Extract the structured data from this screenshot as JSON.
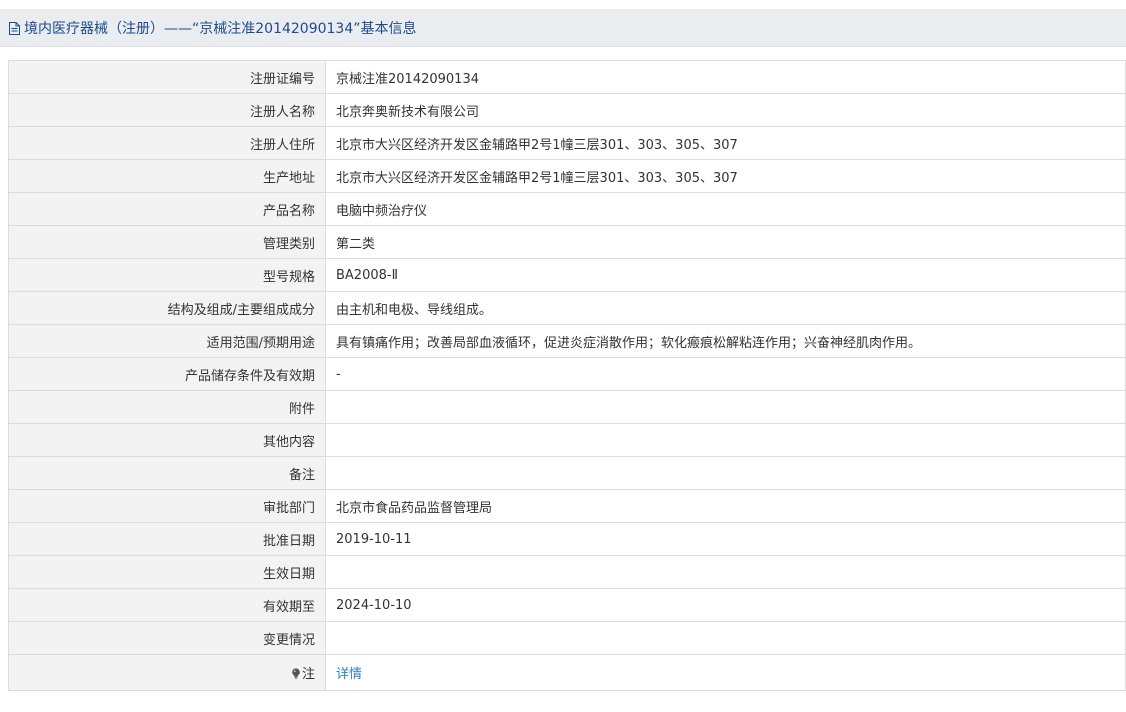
{
  "header": {
    "icon": "document-icon",
    "title": "境内医疗器械（注册）——“京械注准20142090134”基本信息"
  },
  "rows": [
    {
      "label": "注册证编号",
      "value": "京械注准20142090134"
    },
    {
      "label": "注册人名称",
      "value": "北京奔奥新技术有限公司"
    },
    {
      "label": "注册人住所",
      "value": "北京市大兴区经济开发区金辅路甲2号1幢三层301、303、305、307"
    },
    {
      "label": "生产地址",
      "value": "北京市大兴区经济开发区金辅路甲2号1幢三层301、303、305、307"
    },
    {
      "label": "产品名称",
      "value": "电脑中频治疗仪"
    },
    {
      "label": "管理类别",
      "value": "第二类"
    },
    {
      "label": "型号规格",
      "value": "BA2008-Ⅱ"
    },
    {
      "label": "结构及组成/主要组成成分",
      "value": "由主机和电极、导线组成。"
    },
    {
      "label": "适用范围/预期用途",
      "value": "具有镇痛作用；改善局部血液循环，促进炎症消散作用；软化瘢痕松解粘连作用；兴奋神经肌肉作用。"
    },
    {
      "label": "产品储存条件及有效期",
      "value": "-"
    },
    {
      "label": "附件",
      "value": ""
    },
    {
      "label": "其他内容",
      "value": ""
    },
    {
      "label": "备注",
      "value": ""
    },
    {
      "label": "审批部门",
      "value": "北京市食品药品监督管理局"
    },
    {
      "label": "批准日期",
      "value": "2019-10-11"
    },
    {
      "label": "生效日期",
      "value": ""
    },
    {
      "label": "有效期至",
      "value": "2024-10-10"
    },
    {
      "label": "变更情况",
      "value": ""
    }
  ],
  "note": {
    "icon": "lightbulb-icon",
    "label": "注",
    "link_text": "详情"
  },
  "colors": {
    "header_bg": "#eaedf0",
    "title_text": "#1e4a8c",
    "label_bg": "#f3f3f3",
    "border": "#dcdcdc",
    "link": "#2f7fc4"
  }
}
